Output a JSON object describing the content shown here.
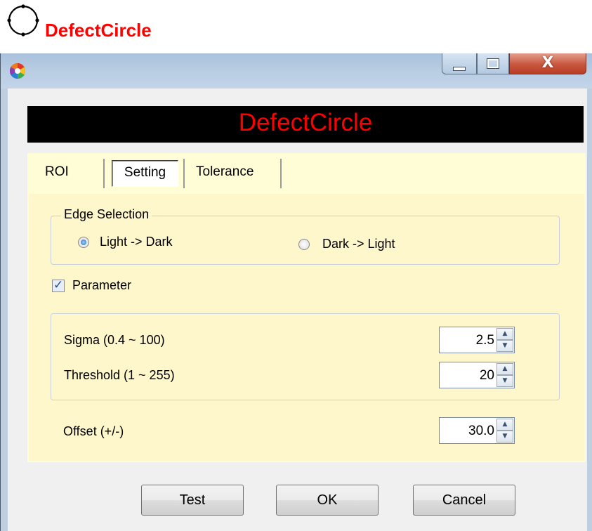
{
  "header": {
    "title": "DefectCircle",
    "icon": "circle-icon"
  },
  "window": {
    "app_icon": "color-wheel-icon",
    "controls": {
      "minimize": "minimize-icon",
      "maximize": "maximize-icon",
      "close": "X"
    },
    "banner_title": "DefectCircle"
  },
  "tabs": [
    {
      "label": "ROI",
      "active": false
    },
    {
      "label": "Setting",
      "active": true
    },
    {
      "label": "Tolerance",
      "active": false
    }
  ],
  "edge_selection": {
    "legend": "Edge Selection",
    "options": [
      {
        "label": "Light -> Dark",
        "selected": true
      },
      {
        "label": "Dark -> Light",
        "selected": false
      }
    ]
  },
  "parameter": {
    "label": "Parameter",
    "checked": true
  },
  "params": {
    "sigma": {
      "label": "Sigma (0.4 ~ 100)",
      "value": "2.5"
    },
    "threshold": {
      "label": "Threshold (1 ~ 255)",
      "value": "20"
    },
    "offset": {
      "label": "Offset (+/-)",
      "value": "30.0"
    }
  },
  "buttons": {
    "test": "Test",
    "ok": "OK",
    "cancel": "Cancel"
  },
  "colors": {
    "accent_red": "#ff0000",
    "banner_bg": "#000000",
    "tab_bg": "#fffdd6",
    "panel_bg": "#fff7cc"
  }
}
